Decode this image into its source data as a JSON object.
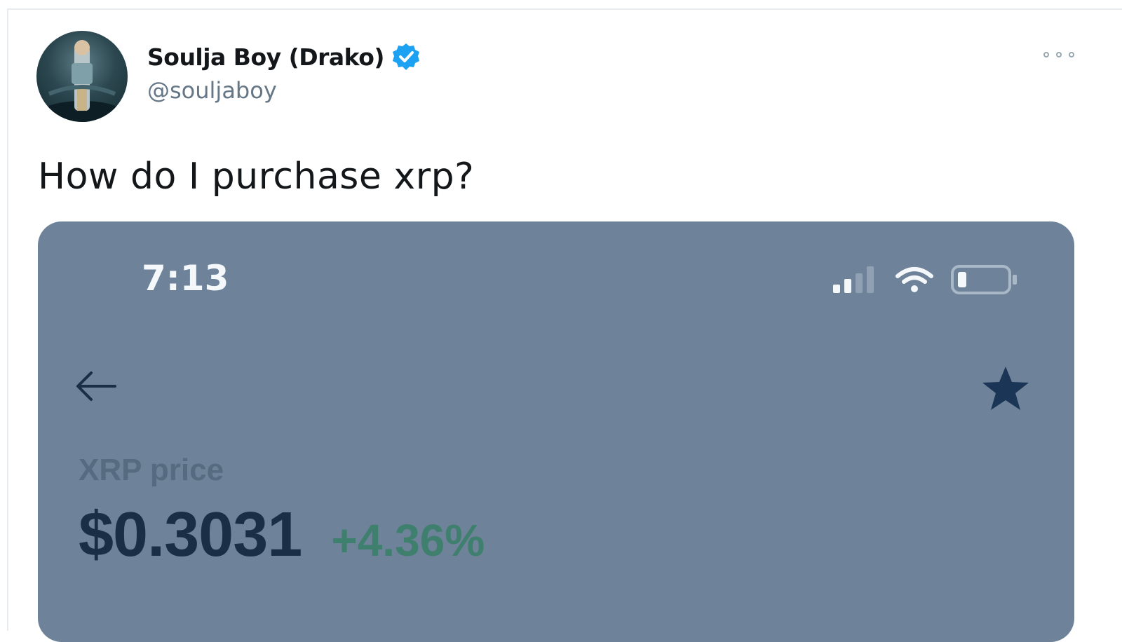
{
  "tweet": {
    "author": {
      "display_name": "Soulja Boy (Drako)",
      "handle": "@souljaboy",
      "verified": true,
      "avatar_icon": "profile-photo"
    },
    "more_icon": "more-horizontal-icon",
    "text": "How do I purchase xrp?",
    "media": {
      "background_color": "#6e8299",
      "status_bar": {
        "time": "7:13",
        "icons": [
          "cellular-signal-icon",
          "wifi-icon",
          "battery-icon"
        ]
      },
      "nav": {
        "back_icon": "back-arrow-icon",
        "favorite_icon": "star-icon"
      },
      "coin_label": "XRP price",
      "price": "$0.3031",
      "change": "+4.36%",
      "change_color": "#3f7f6e",
      "price_color": "#1a2e45"
    }
  },
  "colors": {
    "verified_badge": "#1da1f2",
    "name_text": "#14171a",
    "secondary_text": "#657786"
  }
}
